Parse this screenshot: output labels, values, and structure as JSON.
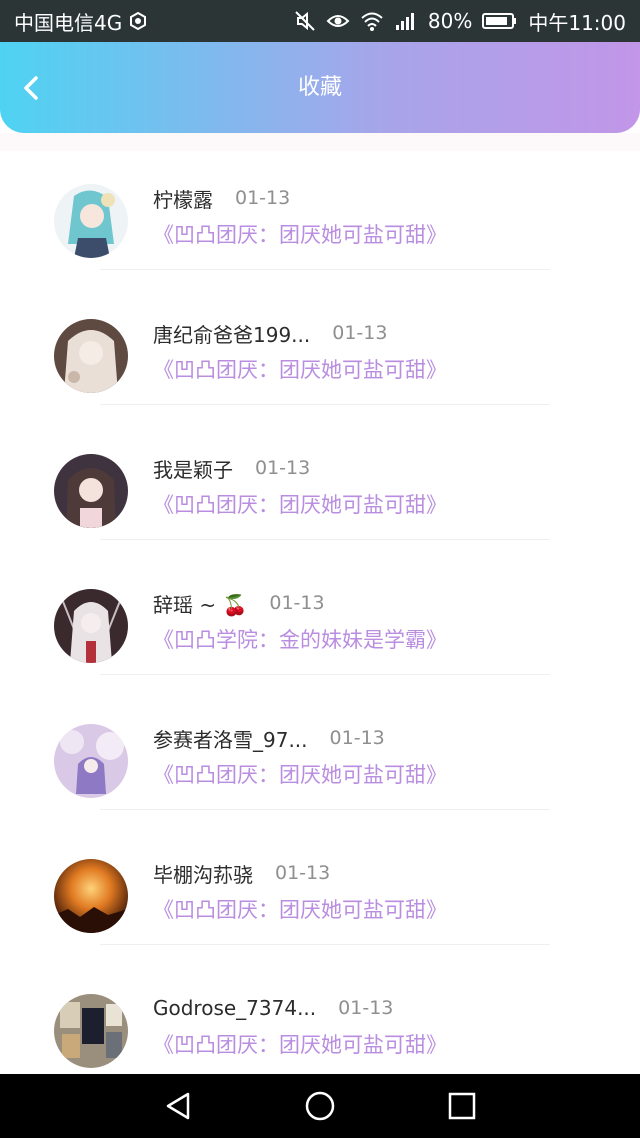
{
  "status_bar": {
    "carrier": "中国电信4G",
    "battery": "80%",
    "time": "中午11:00",
    "icons": [
      "carrier-badge-icon",
      "mute-icon",
      "eye-icon",
      "wifi-icon",
      "signal-icon",
      "battery-icon"
    ]
  },
  "header": {
    "title": "收藏",
    "back_icon": "chevron-left-icon"
  },
  "colors": {
    "header_gradient_start": "#4ed3f2",
    "header_gradient_end": "#c296e8",
    "subtitle": "#b98ee0",
    "name": "#2c2c2c",
    "date": "#8f8f8f"
  },
  "favorites": [
    {
      "name": "柠檬露",
      "date": "01-13",
      "subtitle": "《凹凸团厌：团厌她可盐可甜》"
    },
    {
      "name": "唐纪俞爸爸199...",
      "date": "01-13",
      "subtitle": "《凹凸团厌：团厌她可盐可甜》"
    },
    {
      "name": "我是颖子",
      "date": "01-13",
      "subtitle": "《凹凸团厌：团厌她可盐可甜》"
    },
    {
      "name": "辞瑶 ~ 🍒",
      "date": "01-13",
      "subtitle": "《凹凸学院：金的妹妹是学霸》"
    },
    {
      "name": "参赛者洛雪_97...",
      "date": "01-13",
      "subtitle": "《凹凸团厌：团厌她可盐可甜》"
    },
    {
      "name": "毕棚沟荪骁",
      "date": "01-13",
      "subtitle": "《凹凸团厌：团厌她可盐可甜》"
    },
    {
      "name": "Godrose_7374...",
      "date": "01-13",
      "subtitle": "《凹凸团厌：团厌她可盐可甜》"
    }
  ],
  "nav_bar": {
    "buttons": [
      "back-triangle-icon",
      "home-circle-icon",
      "recents-square-icon"
    ]
  }
}
